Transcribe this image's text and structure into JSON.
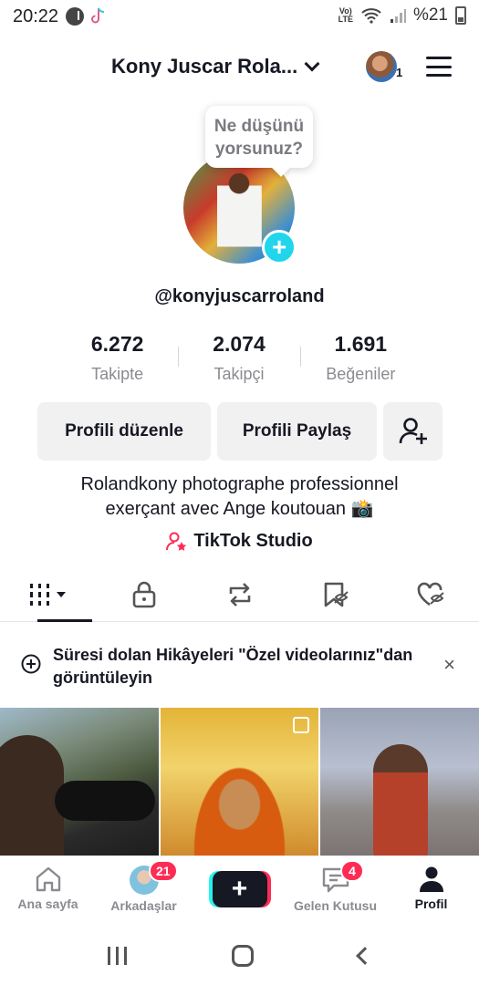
{
  "status": {
    "time": "20:22",
    "network": "Vo)\nLTE",
    "battery": "%21"
  },
  "header": {
    "account_name": "Kony Juscar Rola...",
    "avatar_count": "1"
  },
  "profile": {
    "bubble_text": "Ne düşünü yorsunuz?",
    "username": "@konyjuscarroland",
    "stats": [
      {
        "value": "6.272",
        "label": "Takipte"
      },
      {
        "value": "2.074",
        "label": "Takipçi"
      },
      {
        "value": "1.691",
        "label": "Beğeniler"
      }
    ],
    "buttons": {
      "edit": "Profili düzenle",
      "share": "Profili Paylaş"
    },
    "bio_line1": "Rolandkony photographe professionnel",
    "bio_line2": "exerçant avec Ange koutouan 📸",
    "studio_label": "TikTok Studio"
  },
  "banner": {
    "text": "Süresi dolan Hikâyeleri \"Özel videolarınız\"dan görüntüleyin",
    "close": "×"
  },
  "nav": {
    "home": "Ana sayfa",
    "friends": "Arkadaşlar",
    "friends_badge": "21",
    "create": "+",
    "inbox": "Gelen Kutusu",
    "inbox_badge": "4",
    "profile": "Profil"
  },
  "colors": {
    "accent": "#fe2c55",
    "cyan": "#20d5ec",
    "text": "#161823",
    "muted": "#8a8b91"
  }
}
